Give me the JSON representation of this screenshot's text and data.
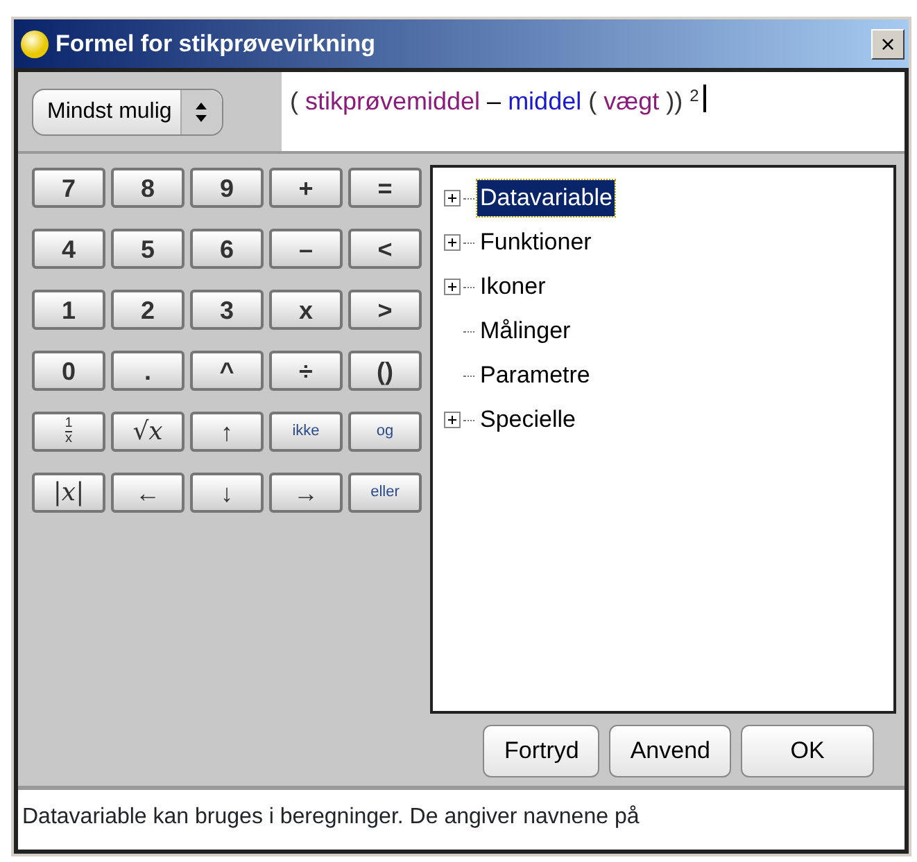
{
  "window": {
    "title": "Formel for stikprøvevirkning",
    "close": "×"
  },
  "size_select": {
    "value": "Mindst mulig"
  },
  "formula": {
    "tokens": [
      {
        "text": "(",
        "kind": "paren"
      },
      {
        "text": "stikprøvemiddel",
        "kind": "variable"
      },
      {
        "text": "–",
        "kind": "operator"
      },
      {
        "text": "middel",
        "kind": "function"
      },
      {
        "text": "(",
        "kind": "paren"
      },
      {
        "text": "vægt",
        "kind": "variable"
      },
      {
        "text": "))",
        "kind": "paren"
      }
    ],
    "exponent": "2"
  },
  "keypad": [
    [
      {
        "label": "7",
        "kind": "plain"
      },
      {
        "label": "8",
        "kind": "plain"
      },
      {
        "label": "9",
        "kind": "plain"
      },
      {
        "label": "+",
        "kind": "plain"
      },
      {
        "label": "=",
        "kind": "plain"
      }
    ],
    [
      {
        "label": "4",
        "kind": "plain"
      },
      {
        "label": "5",
        "kind": "plain"
      },
      {
        "label": "6",
        "kind": "plain"
      },
      {
        "label": "–",
        "kind": "plain"
      },
      {
        "label": "<",
        "kind": "plain"
      }
    ],
    [
      {
        "label": "1",
        "kind": "plain"
      },
      {
        "label": "2",
        "kind": "plain"
      },
      {
        "label": "3",
        "kind": "plain"
      },
      {
        "label": "x",
        "kind": "plain"
      },
      {
        "label": ">",
        "kind": "plain"
      }
    ],
    [
      {
        "label": "0",
        "kind": "plain"
      },
      {
        "label": ".",
        "kind": "plain"
      },
      {
        "label": "^",
        "kind": "plain"
      },
      {
        "label": "÷",
        "kind": "plain"
      },
      {
        "label": "()",
        "kind": "plain"
      }
    ],
    [
      {
        "label": "1",
        "denominator": "x",
        "kind": "fraction"
      },
      {
        "label": "√x",
        "kind": "math"
      },
      {
        "label": "↑",
        "kind": "plain"
      },
      {
        "label": "ikke",
        "kind": "word"
      },
      {
        "label": "og",
        "kind": "word"
      }
    ],
    [
      {
        "label": "|x|",
        "kind": "math"
      },
      {
        "label": "←",
        "kind": "plain"
      },
      {
        "label": "↓",
        "kind": "plain"
      },
      {
        "label": "→",
        "kind": "plain"
      },
      {
        "label": "eller",
        "kind": "word"
      }
    ]
  ],
  "tree": [
    {
      "label": "Datavariable",
      "expandable": true,
      "selected": true
    },
    {
      "label": "Funktioner",
      "expandable": true,
      "selected": false
    },
    {
      "label": "Ikoner",
      "expandable": true,
      "selected": false
    },
    {
      "label": "Målinger",
      "expandable": false,
      "selected": false
    },
    {
      "label": "Parametre",
      "expandable": false,
      "selected": false
    },
    {
      "label": "Specielle",
      "expandable": true,
      "selected": false
    }
  ],
  "buttons": [
    "Fortryd",
    "Anvend",
    "OK"
  ],
  "status_bar": "Datavariable kan bruges i beregninger. De angiver navnene på"
}
